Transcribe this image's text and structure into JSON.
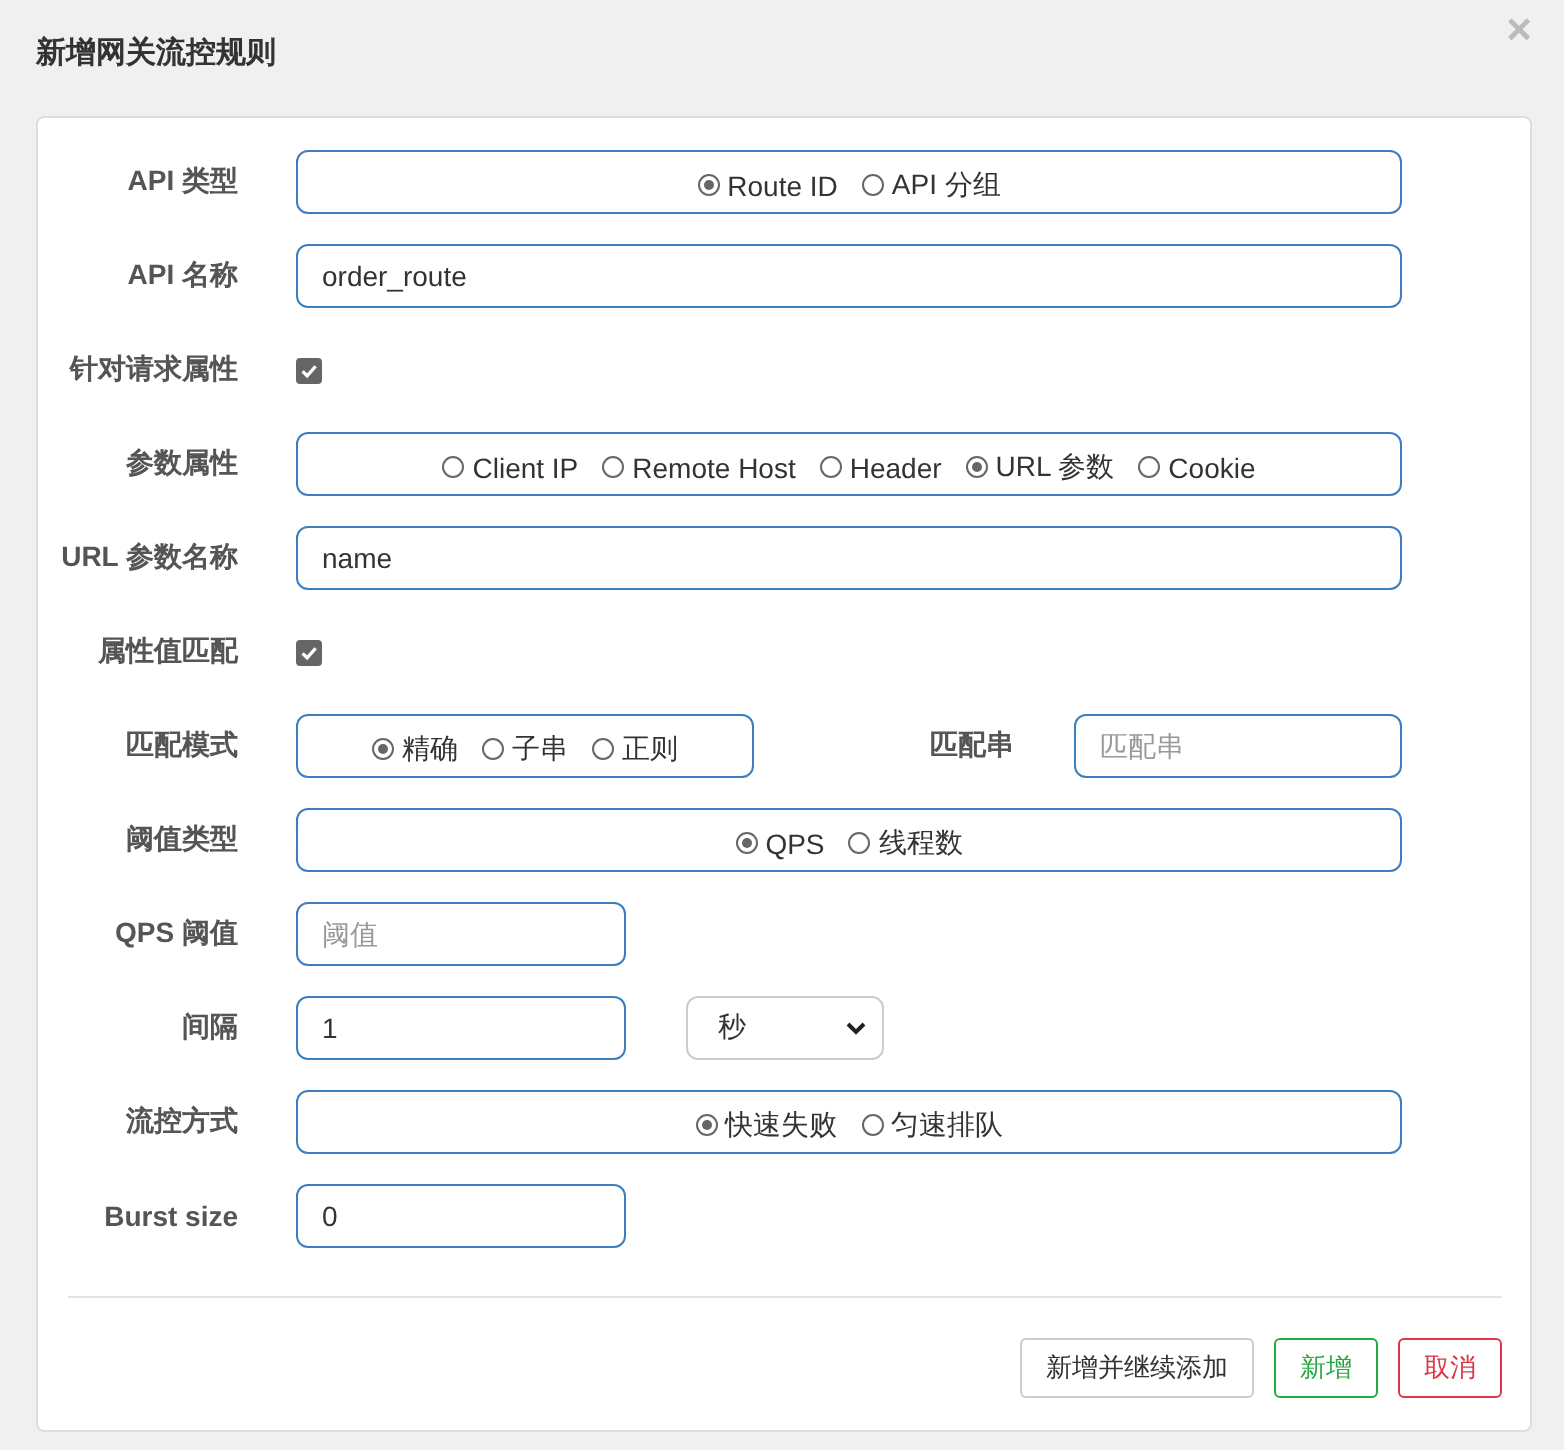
{
  "dialog": {
    "title": "新增网关流控规则",
    "close": "×"
  },
  "rows": [
    {
      "kind": "radio",
      "label": "API 类型",
      "options": [
        {
          "label": "Route ID",
          "selected": true
        },
        {
          "label": "API 分组",
          "selected": false
        }
      ]
    },
    {
      "kind": "text",
      "label": "API 名称",
      "value": "order_route"
    },
    {
      "kind": "checkbox",
      "label": "针对请求属性",
      "checked": true
    },
    {
      "kind": "radio",
      "label": "参数属性",
      "options": [
        {
          "label": "Client IP",
          "selected": false
        },
        {
          "label": "Remote Host",
          "selected": false
        },
        {
          "label": "Header",
          "selected": false
        },
        {
          "label": "URL 参数",
          "selected": true
        },
        {
          "label": "Cookie",
          "selected": false
        }
      ]
    },
    {
      "kind": "text",
      "label": "URL 参数名称",
      "value": "name"
    },
    {
      "kind": "checkbox",
      "label": "属性值匹配",
      "checked": true
    },
    {
      "kind": "match",
      "label": "匹配模式",
      "options": [
        {
          "label": "精确",
          "selected": true
        },
        {
          "label": "子串",
          "selected": false
        },
        {
          "label": "正则",
          "selected": false
        }
      ],
      "field_label": "匹配串",
      "placeholder": "匹配串"
    },
    {
      "kind": "radio",
      "label": "阈值类型",
      "options": [
        {
          "label": "QPS",
          "selected": true
        },
        {
          "label": "线程数",
          "selected": false
        }
      ]
    },
    {
      "kind": "short",
      "label": "QPS 阈值",
      "placeholder": "阈值"
    },
    {
      "kind": "interval",
      "label": "间隔",
      "value": "1",
      "unit": "秒"
    },
    {
      "kind": "radio",
      "label": "流控方式",
      "options": [
        {
          "label": "快速失败",
          "selected": true
        },
        {
          "label": "匀速排队",
          "selected": false
        }
      ]
    },
    {
      "kind": "short",
      "label": "Burst size",
      "value": "0"
    }
  ],
  "buttons": [
    {
      "label": "新增并继续添加",
      "kind": "default"
    },
    {
      "label": "新增",
      "kind": "success"
    },
    {
      "label": "取消",
      "kind": "danger"
    }
  ]
}
